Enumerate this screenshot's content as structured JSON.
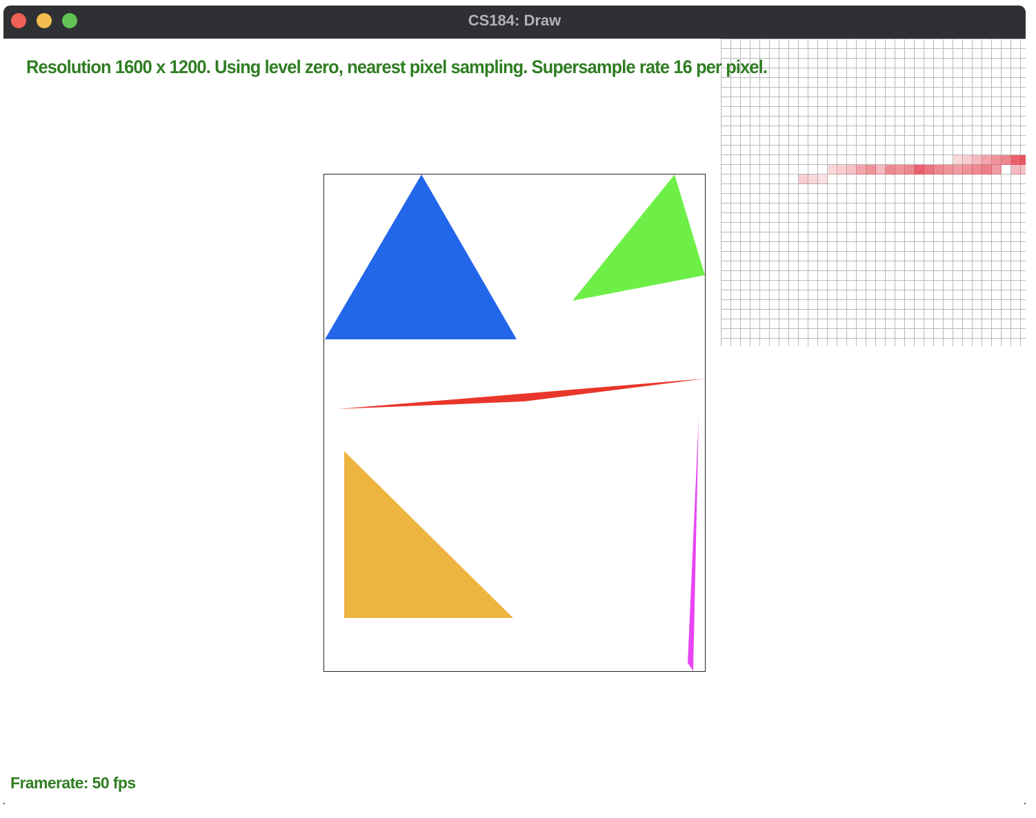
{
  "window": {
    "title": "CS184: Draw",
    "traffic_lights": {
      "close_color": "#ee5f57",
      "minimize_color": "#f3bd4f",
      "zoom_color": "#61c454"
    }
  },
  "overlay": {
    "status": "Resolution 1600 x 1200. Using level zero, nearest pixel sampling. Supersample rate 16 per pixel.",
    "framerate": "Framerate: 50 fps",
    "text_color": "#2f7d22"
  },
  "scene": {
    "background": "#ffffff",
    "triangles": [
      {
        "name": "blue-triangle",
        "color": "#2266ea"
      },
      {
        "name": "green-triangle",
        "color": "#6eef48"
      },
      {
        "name": "red-sliver-triangle",
        "color": "#e8362b"
      },
      {
        "name": "orange-triangle",
        "color": "#edb43f"
      },
      {
        "name": "magenta-sliver-triangle",
        "color": "#e945f4"
      }
    ]
  },
  "zoom_view": {
    "grid_line_color": "#b8b8b8",
    "highlight_color": "#e23a48"
  }
}
